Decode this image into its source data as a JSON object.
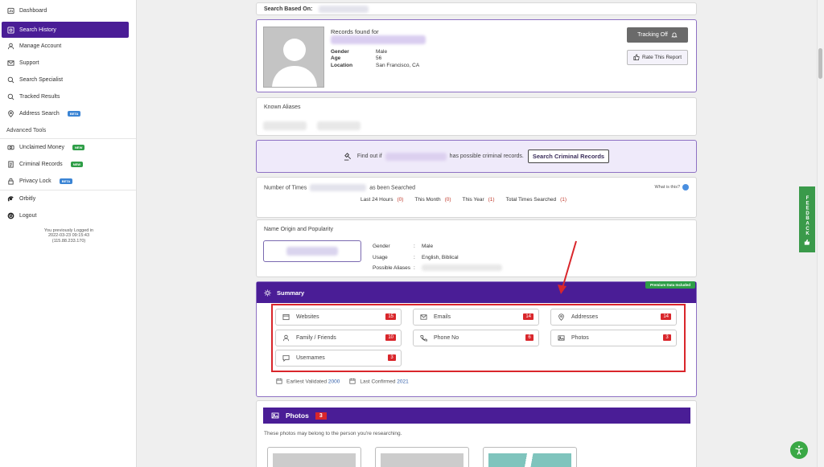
{
  "sidebar": {
    "items": [
      {
        "label": "Dashboard",
        "icon": "dashboard-icon"
      },
      {
        "label": "Search History",
        "icon": "search-history-icon",
        "active": true
      },
      {
        "label": "Manage Account",
        "icon": "user-icon"
      },
      {
        "label": "Support",
        "icon": "envelope-icon"
      },
      {
        "label": "Search Specialist",
        "icon": "search-specialist-icon"
      },
      {
        "label": "Tracked Results",
        "icon": "search-icon"
      },
      {
        "label": "Address Search",
        "icon": "location-pin-icon",
        "badge": "BETA"
      }
    ],
    "section_label": "Advanced Tools",
    "tools": [
      {
        "label": "Unclaimed Money",
        "icon": "money-icon",
        "badge": "NEW"
      },
      {
        "label": "Criminal Records",
        "icon": "criminal-records-icon",
        "badge": "NEW"
      },
      {
        "label": "Privacy Lock",
        "icon": "lock-icon",
        "badge": "BETA"
      }
    ],
    "bottom": [
      {
        "label": "Orbitly",
        "icon": "orbitly-icon"
      },
      {
        "label": "Logout",
        "icon": "power-icon"
      }
    ],
    "login_info": {
      "line1": "You previously Logged in",
      "line2": "2022-03-23 09:15:43",
      "line3": "(115.88.233.170)"
    }
  },
  "search_based": {
    "label": "Search Based On:"
  },
  "profile": {
    "records_found_label": "Records found for",
    "gender_label": "Gender",
    "gender": "Male",
    "age_label": "Age",
    "age": "56",
    "location_label": "Location",
    "location": "San Francisco, CA",
    "tracking_button": "Tracking Off",
    "rate_button": "Rate This Report"
  },
  "aliases": {
    "title": "Known Aliases"
  },
  "criminal": {
    "prefix": "Find out if",
    "suffix": "has possible criminal records.",
    "button": "Search Criminal Records"
  },
  "times": {
    "title_prefix": "Number of Times",
    "title_suffix": "as been Searched",
    "what_is": "What is this?",
    "stats": [
      {
        "label": "Last 24 Hours",
        "value": "(0)"
      },
      {
        "label": "This Month",
        "value": "(0)"
      },
      {
        "label": "This Year",
        "value": "(1)"
      },
      {
        "label": "Total Times Searched",
        "value": "(1)"
      }
    ]
  },
  "origin": {
    "title": "Name Origin and Popularity",
    "gender_label": "Gender",
    "gender": "Male",
    "usage_label": "Usage",
    "usage": "English, Biblical",
    "aliases_label": "Possible Aliases",
    "separator": ":"
  },
  "summary": {
    "title": "Summary",
    "premium_badge": "Premium Data Included",
    "tiles": [
      {
        "label": "Websites",
        "count": "15",
        "icon": "website-icon"
      },
      {
        "label": "Emails",
        "count": "14",
        "icon": "email-icon"
      },
      {
        "label": "Addresses",
        "count": "14",
        "icon": "location-pin-icon"
      },
      {
        "label": "Family / Friends",
        "count": "10",
        "icon": "family-icon"
      },
      {
        "label": "Phone No",
        "count": "6",
        "icon": "phone-icon"
      },
      {
        "label": "Photos",
        "count": "3",
        "icon": "photo-icon"
      },
      {
        "label": "Usernames",
        "count": "3",
        "icon": "chat-icon"
      }
    ],
    "earliest_label": "Earliest Validated",
    "earliest": "2000",
    "confirmed_label": "Last Confirmed",
    "confirmed": "2021"
  },
  "photos": {
    "title": "Photos",
    "count": "3",
    "subtitle": "These photos may belong to the person you're researching."
  },
  "feedback": {
    "label": "FEEDBACK"
  },
  "colors": {
    "brand_purple": "#4a1d96",
    "badge_red": "#d9262b",
    "new_green": "#2e9e47",
    "beta_blue": "#3a84d4",
    "annotation_red": "#d9262b"
  }
}
